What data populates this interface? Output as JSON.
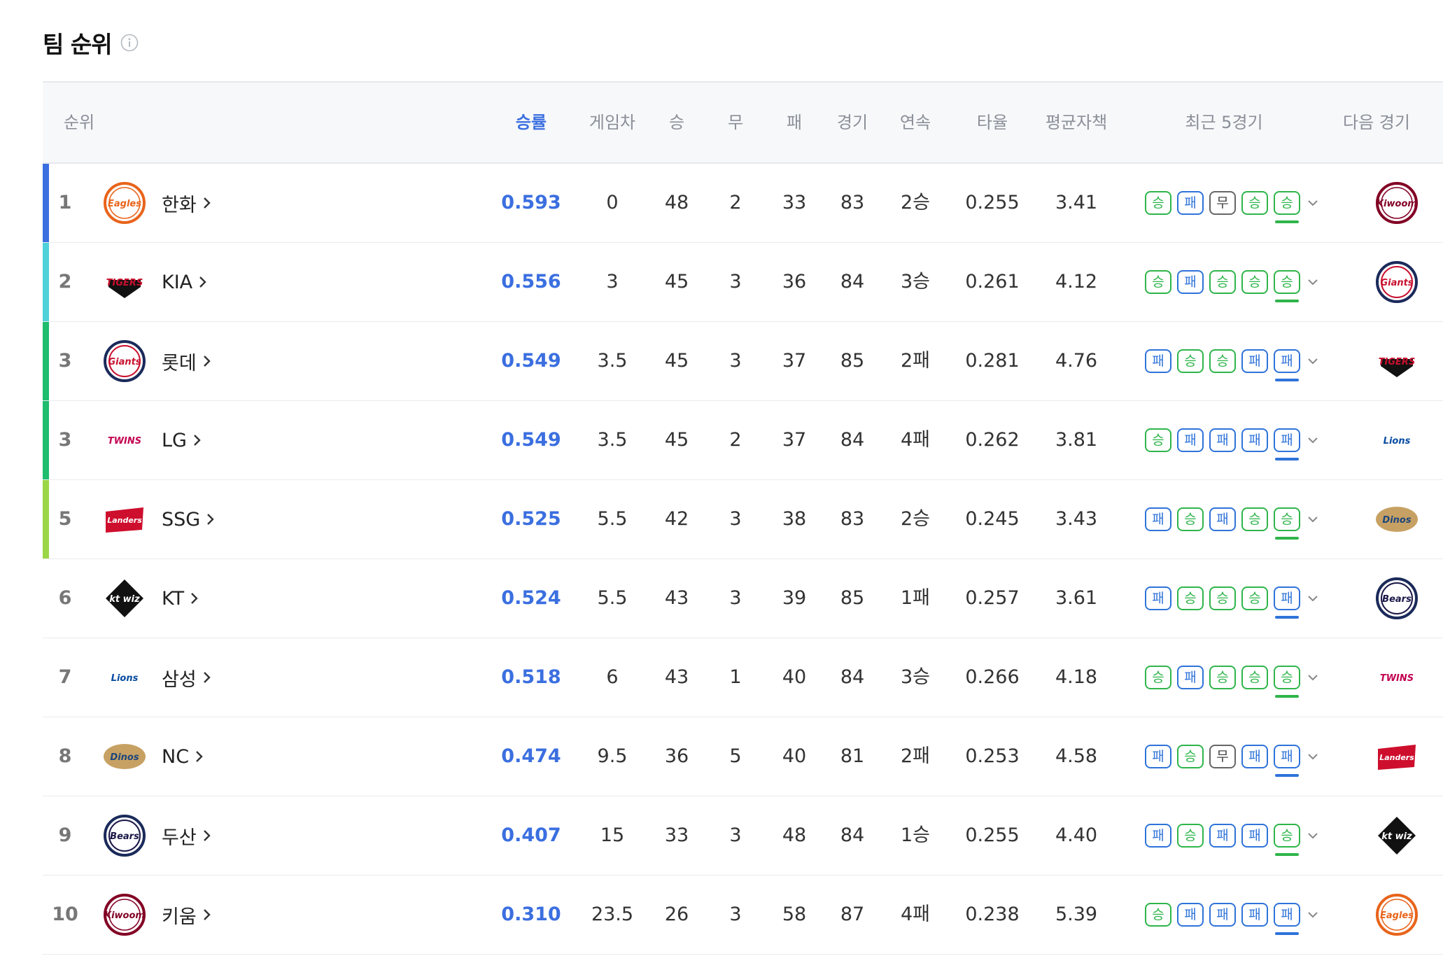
{
  "page": {
    "title": "팀 순위"
  },
  "header": {
    "rank": "순위",
    "pct": "승률",
    "gb": "게임차",
    "w": "승",
    "d": "무",
    "l": "패",
    "g": "경기",
    "streak": "연속",
    "avg": "타율",
    "era": "평균자책",
    "last5": "최근 5경기",
    "next": "다음 경기"
  },
  "teams": {
    "hanwha": {
      "label": "Eagles",
      "color": "#e8641b",
      "fill": "#ffffff",
      "shape": "circle"
    },
    "kia": {
      "label": "TIGERS",
      "color": "#c8102e",
      "fill": "#ffffff",
      "shape": "shield"
    },
    "lotte": {
      "label": "Giants",
      "color": "#c8102e",
      "fill": "#ffffff",
      "shape": "circle-navy"
    },
    "lg": {
      "label": "TWINS",
      "color": "#c30452",
      "fill": "#ffffff",
      "shape": "plain"
    },
    "ssg": {
      "label": "Landers",
      "color": "#ce0e2d",
      "fill": "#ffffff",
      "shape": "banner"
    },
    "kt": {
      "label": "kt wiz",
      "color": "#111111",
      "fill": "#ffffff",
      "shape": "dark"
    },
    "samsung": {
      "label": "Lions",
      "color": "#074ca1",
      "fill": "#ffffff",
      "shape": "plain"
    },
    "nc": {
      "label": "Dinos",
      "color": "#1d467d",
      "fill": "#c7a163",
      "shape": "oval"
    },
    "doosan": {
      "label": "Bears",
      "color": "#1a1748",
      "fill": "#ffffff",
      "shape": "circle-navy"
    },
    "kiwoom": {
      "label": "Kiwoom",
      "color": "#820024",
      "fill": "#ffffff",
      "shape": "circle"
    }
  },
  "rows": [
    {
      "rank": "1",
      "team": "한화",
      "logo": "hanwha",
      "bar": "#3b6fe0",
      "pct": "0.593",
      "gb": "0",
      "w": "48",
      "d": "2",
      "l": "33",
      "g": "83",
      "streak": "2승",
      "avg": "0.255",
      "era": "3.41",
      "last5": [
        "승",
        "패",
        "무",
        "승",
        "승"
      ],
      "next": "kiwoom"
    },
    {
      "rank": "2",
      "team": "KIA",
      "logo": "kia",
      "bar": "#4fd1d9",
      "pct": "0.556",
      "gb": "3",
      "w": "45",
      "d": "3",
      "l": "36",
      "g": "84",
      "streak": "3승",
      "avg": "0.261",
      "era": "4.12",
      "last5": [
        "승",
        "패",
        "승",
        "승",
        "승"
      ],
      "next": "lotte"
    },
    {
      "rank": "3",
      "team": "롯데",
      "logo": "lotte",
      "bar": "#1fbd6e",
      "pct": "0.549",
      "gb": "3.5",
      "w": "45",
      "d": "3",
      "l": "37",
      "g": "85",
      "streak": "2패",
      "avg": "0.281",
      "era": "4.76",
      "last5": [
        "패",
        "승",
        "승",
        "패",
        "패"
      ],
      "next": "kia"
    },
    {
      "rank": "3",
      "team": "LG",
      "logo": "lg",
      "bar": "#1fbd6e",
      "pct": "0.549",
      "gb": "3.5",
      "w": "45",
      "d": "2",
      "l": "37",
      "g": "84",
      "streak": "4패",
      "avg": "0.262",
      "era": "3.81",
      "last5": [
        "승",
        "패",
        "패",
        "패",
        "패"
      ],
      "next": "samsung"
    },
    {
      "rank": "5",
      "team": "SSG",
      "logo": "ssg",
      "bar": "#9bd647",
      "pct": "0.525",
      "gb": "5.5",
      "w": "42",
      "d": "3",
      "l": "38",
      "g": "83",
      "streak": "2승",
      "avg": "0.245",
      "era": "3.43",
      "last5": [
        "패",
        "승",
        "패",
        "승",
        "승"
      ],
      "next": "nc"
    },
    {
      "rank": "6",
      "team": "KT",
      "logo": "kt",
      "bar": "",
      "pct": "0.524",
      "gb": "5.5",
      "w": "43",
      "d": "3",
      "l": "39",
      "g": "85",
      "streak": "1패",
      "avg": "0.257",
      "era": "3.61",
      "last5": [
        "패",
        "승",
        "승",
        "승",
        "패"
      ],
      "next": "doosan"
    },
    {
      "rank": "7",
      "team": "삼성",
      "logo": "samsung",
      "bar": "",
      "pct": "0.518",
      "gb": "6",
      "w": "43",
      "d": "1",
      "l": "40",
      "g": "84",
      "streak": "3승",
      "avg": "0.266",
      "era": "4.18",
      "last5": [
        "승",
        "패",
        "승",
        "승",
        "승"
      ],
      "next": "lg"
    },
    {
      "rank": "8",
      "team": "NC",
      "logo": "nc",
      "bar": "",
      "pct": "0.474",
      "gb": "9.5",
      "w": "36",
      "d": "5",
      "l": "40",
      "g": "81",
      "streak": "2패",
      "avg": "0.253",
      "era": "4.58",
      "last5": [
        "패",
        "승",
        "무",
        "패",
        "패"
      ],
      "next": "ssg"
    },
    {
      "rank": "9",
      "team": "두산",
      "logo": "doosan",
      "bar": "",
      "pct": "0.407",
      "gb": "15",
      "w": "33",
      "d": "3",
      "l": "48",
      "g": "84",
      "streak": "1승",
      "avg": "0.255",
      "era": "4.40",
      "last5": [
        "패",
        "승",
        "패",
        "패",
        "승"
      ],
      "next": "kt"
    },
    {
      "rank": "10",
      "team": "키움",
      "logo": "kiwoom",
      "bar": "",
      "pct": "0.310",
      "gb": "23.5",
      "w": "26",
      "d": "3",
      "l": "58",
      "g": "87",
      "streak": "4패",
      "avg": "0.238",
      "era": "5.39",
      "last5": [
        "승",
        "패",
        "패",
        "패",
        "패"
      ],
      "next": "hanwha"
    }
  ]
}
